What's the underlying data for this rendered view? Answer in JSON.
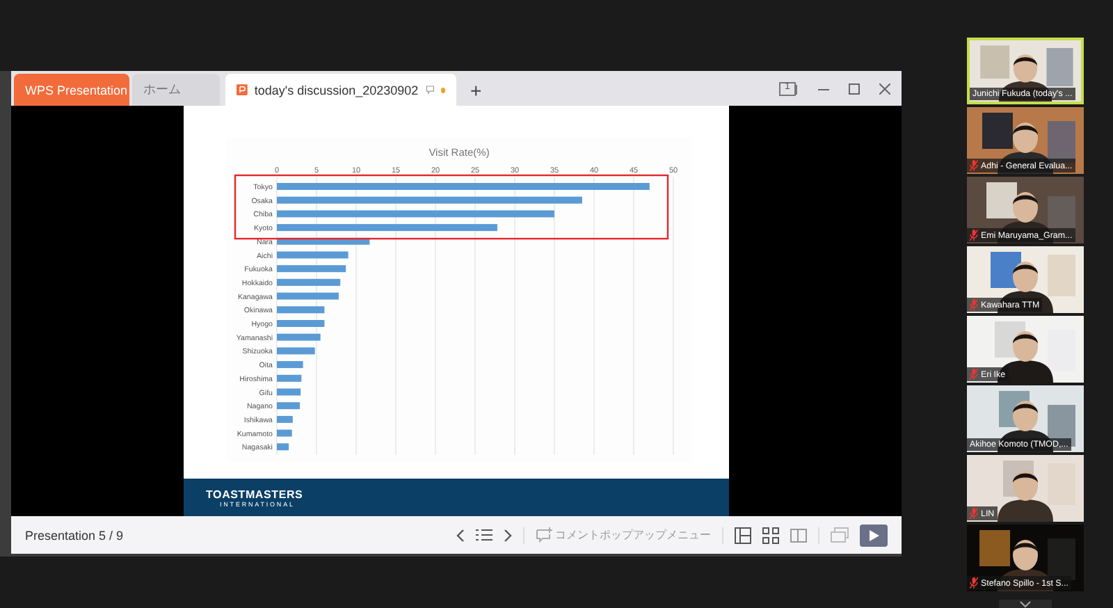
{
  "presentation_window": {
    "tabs": [
      {
        "kind": "app",
        "label": "WPS Presentation",
        "selected": false
      },
      {
        "kind": "home",
        "label": "ホーム",
        "selected": false
      },
      {
        "kind": "document",
        "label": "today's discussion_20230902",
        "selected": true,
        "unsaved": true
      }
    ],
    "new_tab": "+",
    "window_badge": "1",
    "slide": {
      "chart_data": {
        "type": "bar",
        "orientation": "horizontal",
        "title": "Visit Rate(%)",
        "categories": [
          "Tokyo",
          "Osaka",
          "Chiba",
          "Kyoto",
          "Nara",
          "Aichi",
          "Fukuoka",
          "Hokkaido",
          "Kanagawa",
          "Okinawa",
          "Hyogo",
          "Yamanashi",
          "Shizuoka",
          "Oita",
          "Hiroshima",
          "Gifu",
          "Nagano",
          "Ishikawa",
          "Kumamoto",
          "Nagasaki"
        ],
        "series": [
          {
            "color": "#5b9bd5",
            "values": [
              47,
              38.5,
              35,
              27.8,
              11.7,
              9,
              8.7,
              8,
              7.8,
              6,
              6,
              5.5,
              4.8,
              3.3,
              3.1,
              3,
              2.9,
              2,
              1.9,
              1.5
            ]
          }
        ],
        "xlim": [
          0,
          50
        ],
        "xticks": [
          0,
          5,
          10,
          15,
          20,
          25,
          30,
          35,
          40,
          45,
          50
        ],
        "grid": true
      },
      "highlight_box": true,
      "footer": {
        "logo": "TOASTMASTERS",
        "logo_sub": "INTERNATIONAL"
      }
    },
    "status_bar": {
      "slide_counter": "Presentation 5 / 9",
      "comment_menu": {
        "label": "コメントポップアップメニュー",
        "disabled": true
      }
    }
  },
  "participants": [
    {
      "name": "Junichi Fukuda (today's ...",
      "muted": false,
      "speaking": true
    },
    {
      "name": "Adhi - General Evalua...",
      "muted": true,
      "speaking": false
    },
    {
      "name": "Emi Maruyama_Gram...",
      "muted": true,
      "speaking": false
    },
    {
      "name": "Kawahara TTM",
      "muted": true,
      "speaking": false
    },
    {
      "name": "Eri Ike",
      "muted": true,
      "speaking": false
    },
    {
      "name": "Akihoe Komoto (TMOD,...",
      "muted": false,
      "speaking": false
    },
    {
      "name": "LIN",
      "muted": true,
      "speaking": false
    },
    {
      "name": "Stefano Spillo - 1st S...",
      "muted": true,
      "speaking": false
    }
  ]
}
